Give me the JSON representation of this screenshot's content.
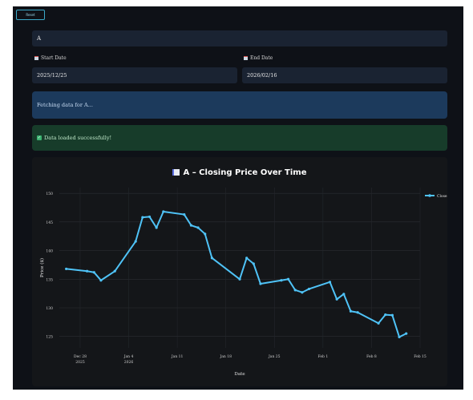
{
  "reset_button": "Reset",
  "ticker": {
    "value": "A"
  },
  "start_date": {
    "label": "Start Date",
    "value": "2025/12/25"
  },
  "end_date": {
    "label": "End Date",
    "value": "2026/02/16"
  },
  "info_message": "Fetching data for A...",
  "success_message": "Data loaded successfully!",
  "colors": {
    "line": "#4fc3f7",
    "info_bg": "#1c3a5c",
    "success_bg": "#173c2a",
    "app_bg": "#0e1117"
  },
  "chart_data": {
    "type": "line",
    "title": "A – Closing Price Over Time",
    "xlabel": "Date",
    "ylabel": "Price ($)",
    "ylim": [
      123,
      151
    ],
    "yticks": [
      125,
      130,
      135,
      140,
      145,
      150
    ],
    "x_ticks": [
      {
        "date": "2025-12-28",
        "label": [
          "Dec 28",
          "2025"
        ]
      },
      {
        "date": "2026-01-04",
        "label": [
          "Jan 4",
          "2026"
        ]
      },
      {
        "date": "2026-01-11",
        "label": [
          "Jan 11"
        ]
      },
      {
        "date": "2026-01-18",
        "label": [
          "Jan 18"
        ]
      },
      {
        "date": "2026-01-25",
        "label": [
          "Jan 25"
        ]
      },
      {
        "date": "2026-02-01",
        "label": [
          "Feb 1"
        ]
      },
      {
        "date": "2026-02-08",
        "label": [
          "Feb 8"
        ]
      },
      {
        "date": "2026-02-15",
        "label": [
          "Feb 15"
        ]
      }
    ],
    "xlim": [
      "2025-12-25",
      "2026-02-15"
    ],
    "legend": {
      "position": "top-right"
    },
    "grid": true,
    "series": [
      {
        "name": "Close",
        "x": [
          "2025-12-26",
          "2025-12-29",
          "2025-12-30",
          "2025-12-31",
          "2026-01-02",
          "2026-01-05",
          "2026-01-06",
          "2026-01-07",
          "2026-01-08",
          "2026-01-09",
          "2026-01-12",
          "2026-01-13",
          "2026-01-14",
          "2026-01-15",
          "2026-01-16",
          "2026-01-20",
          "2026-01-21",
          "2026-01-22",
          "2026-01-23",
          "2026-01-26",
          "2026-01-27",
          "2026-01-28",
          "2026-01-29",
          "2026-01-30",
          "2026-02-02",
          "2026-02-03",
          "2026-02-04",
          "2026-02-05",
          "2026-02-06",
          "2026-02-09",
          "2026-02-10",
          "2026-02-11",
          "2026-02-12",
          "2026-02-13"
        ],
        "values": [
          136.8,
          136.4,
          136.2,
          134.8,
          136.4,
          141.6,
          145.8,
          145.9,
          144.0,
          146.8,
          146.3,
          144.4,
          144.0,
          142.9,
          138.7,
          135.0,
          138.7,
          137.7,
          134.2,
          134.8,
          135.0,
          133.1,
          132.7,
          133.3,
          134.5,
          131.5,
          132.4,
          129.4,
          129.2,
          127.3,
          128.8,
          128.7,
          124.9,
          125.5
        ]
      }
    ]
  }
}
